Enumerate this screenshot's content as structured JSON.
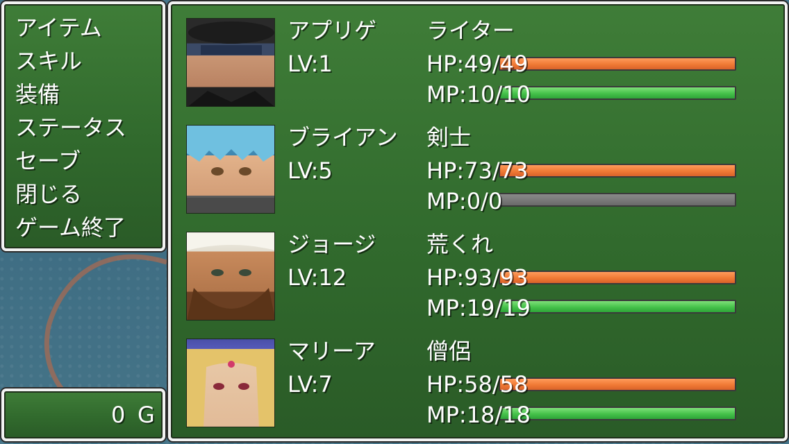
{
  "menu": {
    "items": [
      "アイテム",
      "スキル",
      "装備",
      "ステータス",
      "セーブ",
      "閉じる",
      "ゲーム終了"
    ]
  },
  "gold": {
    "amount": "0",
    "unit": "G"
  },
  "party": [
    {
      "name": "アプリゲ",
      "class": "ライター",
      "level": "LV:1",
      "hp_text": "HP:49/49",
      "mp_text": "MP:10/10",
      "hp_ratio": 1,
      "mp_ratio": 1,
      "face_icon": "masked-man-face"
    },
    {
      "name": "ブライアン",
      "class": "剣士",
      "level": "LV:5",
      "hp_text": "HP:73/73",
      "mp_text": "MP:0/0",
      "hp_ratio": 1,
      "mp_ratio": 0,
      "face_icon": "blue-haired-swordsman-face"
    },
    {
      "name": "ジョージ",
      "class": "荒くれ",
      "level": "LV:12",
      "hp_text": "HP:93/93",
      "mp_text": "MP:19/19",
      "hp_ratio": 1,
      "mp_ratio": 1,
      "face_icon": "bearded-turban-man-face"
    },
    {
      "name": "マリーア",
      "class": "僧侶",
      "level": "LV:7",
      "hp_text": "HP:58/58",
      "mp_text": "MP:18/18",
      "hp_ratio": 1,
      "mp_ratio": 1,
      "face_icon": "blonde-priestess-face"
    }
  ],
  "colors": {
    "window_green": "#316a2d",
    "hp_bar": "#f07a35",
    "mp_bar": "#45c24a",
    "empty_bar": "#6d6d6d"
  }
}
